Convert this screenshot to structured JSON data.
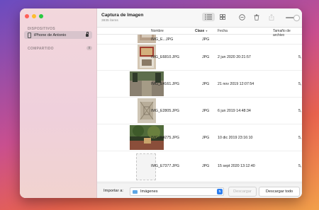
{
  "sidebar": {
    "devices_title": "DISPOSITIVOS",
    "device_item": "iPhone de Antonio",
    "shared_title": "COMPARTIDO",
    "shared_count": "0"
  },
  "titlebar": {
    "title": "Captura de Imagen",
    "subtitle": "3935 ítems",
    "zoom_level": 0.8
  },
  "columns": {
    "name": "Nombre",
    "kind": "Clase",
    "date": "Fecha",
    "size": "Tamaño de archivo"
  },
  "rows": [
    {
      "name": "IMG_E...JPG",
      "kind": "JPG",
      "date": "",
      "size": "",
      "thumb": "photo-rug"
    },
    {
      "name": "IMG_E6810.JPG",
      "kind": "JPG",
      "date": "2 jun 2020 20:21:57",
      "size": "5,",
      "thumb": "photo-rug-wall"
    },
    {
      "name": "IMG_E4161.JPG",
      "kind": "JPG",
      "date": "21 nov 2019 12:07:54",
      "size": "5,",
      "thumb": "photo-street"
    },
    {
      "name": "IMG_E2805.JPG",
      "kind": "JPG",
      "date": "6 jun 2019 14:48:34",
      "size": "5,",
      "thumb": "photo-tile"
    },
    {
      "name": "IMG_E4275.JPG",
      "kind": "JPG",
      "date": "10 dic 2019 23:16:10",
      "size": "5,",
      "thumb": "photo-trees"
    },
    {
      "name": "IMG_E7377.JPG",
      "kind": "JPG",
      "date": "15 sept 2020 13:12:40",
      "size": "5,",
      "thumb": "photo-placeholder"
    }
  ],
  "bottom": {
    "import_label": "Importar a:",
    "destination": "Imágenes",
    "download_label": "Descargar",
    "download_all_label": "Descargar todo"
  },
  "colors": {
    "accent": "#2d7ff0",
    "traffic_red": "#fe5f57",
    "traffic_yellow": "#febc2e",
    "traffic_green": "#28c840"
  }
}
